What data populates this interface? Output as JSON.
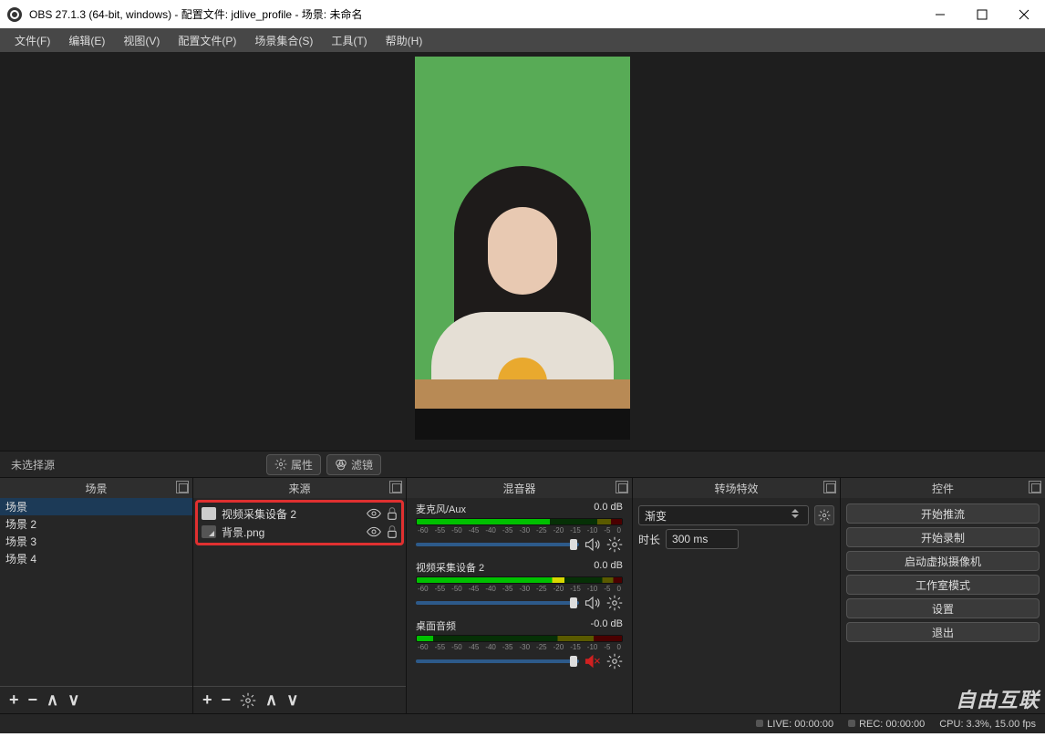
{
  "title": "OBS 27.1.3 (64-bit, windows) - 配置文件: jdlive_profile - 场景: 未命名",
  "menu": {
    "file": "文件(F)",
    "edit": "编辑(E)",
    "view": "视图(V)",
    "profile": "配置文件(P)",
    "scenes": "场景集合(S)",
    "tools": "工具(T)",
    "help": "帮助(H)"
  },
  "toolbar": {
    "no_sel": "未选择源",
    "props": "属性",
    "filters": "滤镜"
  },
  "panels": {
    "scenes": {
      "title": "场景",
      "items": [
        "场景",
        "场景 2",
        "场景 3",
        "场景 4"
      ]
    },
    "sources": {
      "title": "来源",
      "items": [
        "视频采集设备 2",
        "背景.png"
      ]
    },
    "mixer": {
      "title": "混音器",
      "channels": [
        {
          "name": "麦克风/Aux",
          "db": "0.0 dB",
          "mask": 35,
          "muted": false
        },
        {
          "name": "视频采集设备 2",
          "db": "0.0 dB",
          "mask": 28,
          "muted": false
        },
        {
          "name": "桌面音频",
          "db": "-0.0 dB",
          "mask": 92,
          "muted": true
        }
      ],
      "ticks": [
        "-60",
        "-55",
        "-50",
        "-45",
        "-40",
        "-35",
        "-30",
        "-25",
        "-20",
        "-15",
        "-10",
        "-5",
        "0"
      ]
    },
    "transitions": {
      "title": "转场特效",
      "type": "渐变",
      "dur_lbl": "时长",
      "dur": "300 ms"
    },
    "controls": {
      "title": "控件",
      "buttons": [
        "开始推流",
        "开始录制",
        "启动虚拟摄像机",
        "工作室模式",
        "设置",
        "退出"
      ]
    }
  },
  "status": {
    "live": "LIVE: 00:00:00",
    "rec": "REC: 00:00:00",
    "cpu": "CPU: 3.3%, 15.00 fps"
  },
  "watermark": "自由互联"
}
